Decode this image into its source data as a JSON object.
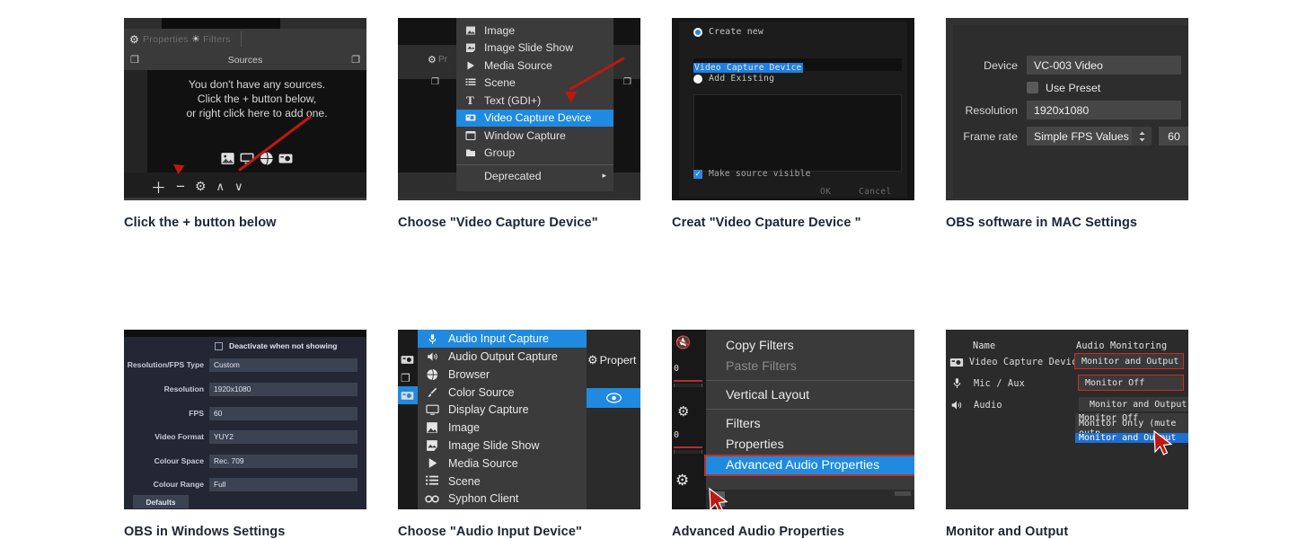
{
  "panels": [
    {
      "id": "panel-sources-empty",
      "caption": "Click the + button below",
      "app": {
        "tabs": [
          "Properties",
          "Filters"
        ],
        "dock_title": "Sources",
        "empty_message_lines": [
          "You don't have any sources.",
          "Click the + button below,",
          "or right click here to add one."
        ],
        "source_type_icons": [
          "image-icon",
          "display-icon",
          "browser-icon",
          "camera-icon"
        ],
        "toolbar_icons": [
          "add-icon",
          "remove-icon",
          "gear-icon",
          "move-up-icon",
          "move-down-icon"
        ],
        "toolbar_glyphs": [
          "＋",
          "−",
          "⚙",
          "∧",
          "∨"
        ]
      }
    },
    {
      "id": "panel-source-type-menu",
      "caption": "Choose \"Video Capture Device\"",
      "menu": {
        "items": [
          {
            "label": "Image",
            "icon": "image-icon",
            "selected": false
          },
          {
            "label": "Image Slide Show",
            "icon": "slideshow-icon",
            "selected": false
          },
          {
            "label": "Media Source",
            "icon": "play-icon",
            "selected": false
          },
          {
            "label": "Scene",
            "icon": "scene-icon",
            "selected": false
          },
          {
            "label": "Text (GDI+)",
            "icon": "text-icon",
            "selected": false
          },
          {
            "label": "Video Capture Device",
            "icon": "camera-icon",
            "selected": true
          },
          {
            "label": "Window Capture",
            "icon": "window-icon",
            "selected": false
          },
          {
            "label": "Group",
            "icon": "folder-icon",
            "selected": false
          }
        ],
        "submenu_label": "Deprecated",
        "submenu_arrow": "▸",
        "background_labels": {
          "properties": "Pr"
        }
      }
    },
    {
      "id": "panel-create-source-dialog",
      "caption": "Creat \"Video Cpature Device \"",
      "dialog": {
        "create_new_label": "Create new",
        "source_name_value": "Video Capture Device",
        "add_existing_label": "Add Existing",
        "make_visible_label": "Make source visible",
        "make_visible_checked": true,
        "buttons": [
          "OK",
          "Cancel"
        ]
      }
    },
    {
      "id": "panel-mac-device-settings",
      "caption": "OBS software in MAC Settings",
      "settings": {
        "rows": [
          {
            "label": "Device",
            "value": "VC-003 Video"
          },
          {
            "label": "Resolution",
            "value": "1920x1080"
          }
        ],
        "use_preset_label": "Use Preset",
        "use_preset_checked": false,
        "frame_rate_label": "Frame rate",
        "frame_rate_value": "Simple FPS Values",
        "frame_rate_stepper_glyph": "⌃⌄",
        "fps_value": "60"
      }
    },
    {
      "id": "panel-windows-device-settings",
      "caption": "OBS in Windows Settings",
      "settings": {
        "deactivate_label": "Deactivate when not showing",
        "deactivate_checked": false,
        "rows": [
          {
            "label": "Resolution/FPS Type",
            "value": "Custom"
          },
          {
            "label": "Resolution",
            "value": "1920x1080"
          },
          {
            "label": "FPS",
            "value": "60"
          },
          {
            "label": "Video Format",
            "value": "YUY2"
          },
          {
            "label": "Colour Space",
            "value": "Rec. 709"
          },
          {
            "label": "Colour Range",
            "value": "Full"
          }
        ],
        "defaults_button": "Defaults"
      }
    },
    {
      "id": "panel-audio-source-menu",
      "caption": "Choose \"Audio Input Device\"",
      "menu": {
        "items": [
          {
            "label": "Audio Input Capture",
            "icon": "microphone-icon",
            "selected": true
          },
          {
            "label": "Audio Output Capture",
            "icon": "speaker-icon",
            "selected": false
          },
          {
            "label": "Browser",
            "icon": "browser-icon",
            "selected": false
          },
          {
            "label": "Color Source",
            "icon": "brush-icon",
            "selected": false
          },
          {
            "label": "Display Capture",
            "icon": "display-icon",
            "selected": false
          },
          {
            "label": "Image",
            "icon": "image-icon",
            "selected": false
          },
          {
            "label": "Image Slide Show",
            "icon": "slideshow-icon",
            "selected": false
          },
          {
            "label": "Media Source",
            "icon": "play-icon",
            "selected": false
          },
          {
            "label": "Scene",
            "icon": "scene-icon",
            "selected": false
          },
          {
            "label": "Syphon Client",
            "icon": "syphon-icon",
            "selected": false
          }
        ],
        "properties_label": "Propert",
        "eye_icon": "eye-icon"
      }
    },
    {
      "id": "panel-advanced-audio-menu",
      "caption": "Advanced Audio Properties",
      "menu": {
        "items": [
          {
            "label": "Copy Filters",
            "disabled": false
          },
          {
            "label": "Paste Filters",
            "disabled": true
          },
          {
            "label": "Vertical Layout",
            "disabled": false
          },
          {
            "label": "Filters",
            "disabled": false
          },
          {
            "label": "Properties",
            "disabled": false
          }
        ],
        "highlighted_item": "Advanced Audio Properties",
        "meter_values": [
          "0",
          "0"
        ]
      }
    },
    {
      "id": "panel-monitor-and-output",
      "caption": "Monitor and Output",
      "table": {
        "headers": [
          "Name",
          "Audio Monitoring"
        ],
        "rows": [
          {
            "icon": "camera-icon",
            "name": "Video Capture Device",
            "monitoring": "Monitor and Output",
            "highlighted": true
          },
          {
            "icon": "microphone-icon",
            "name": "Mic / Aux",
            "monitoring": "Monitor Off",
            "highlighted": true
          },
          {
            "icon": "speaker-icon",
            "name": "Audio",
            "monitoring": "Monitor and Output",
            "highlighted": false
          }
        ],
        "dropdown_current": "Monitor and Output",
        "dropdown_options": [
          {
            "label": "Monitor Off",
            "selected": false
          },
          {
            "label": "Monitor Only (mute outp",
            "selected": false
          },
          {
            "label": "Monitor and Output",
            "selected": true
          }
        ]
      }
    }
  ],
  "colors": {
    "accent_blue": "#1f8ae0",
    "arrow_red": "#c0180f",
    "highlight_red": "#cf2b20",
    "caption_text": "#1b2536"
  }
}
